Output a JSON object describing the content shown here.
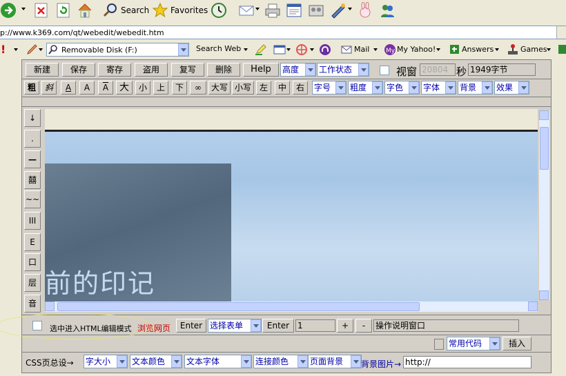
{
  "toolbar": {
    "search_label": "Search",
    "favorites_label": "Favorites"
  },
  "address": {
    "url": "p://www.k369.com/qt/webedit/webedit.htm"
  },
  "yahoo_bar": {
    "drive_select": "Removable Disk (F:)",
    "search_web": "Search Web",
    "mail": "Mail",
    "my_yahoo": "My Yahoo!",
    "answers": "Answers",
    "games": "Games"
  },
  "editor": {
    "row1": {
      "new": "新建",
      "save": "保存",
      "store": "寄存",
      "steal": "盗用",
      "copy": "复写",
      "delete": "删除",
      "help": "Help",
      "height_select": "高度",
      "status_select": "工作状态",
      "window_label": "视窗",
      "window_value": "20804",
      "sec_label": "秒",
      "bytes_value": "1949字节"
    },
    "row2": {
      "buttons": [
        "粗",
        "斜",
        "A",
        "A",
        "A",
        "大",
        "小",
        "上",
        "下",
        "∞",
        "大写",
        "小写",
        "左",
        "中",
        "右"
      ],
      "selects": [
        "字号",
        "粗度",
        "字色",
        "字体",
        "背景",
        "效果"
      ]
    },
    "side_buttons": [
      "↓",
      ".",
      "—",
      "囍",
      "~~",
      "III",
      "E",
      "口",
      "层",
      "音"
    ],
    "canvas_text": "前的印记",
    "bottom1": {
      "html_mode_label": "选中进入HTML编辑模式",
      "browse_link": "浏览网页",
      "enter1": "Enter",
      "form_select": "选择表单",
      "enter2": "Enter",
      "count_value": "1",
      "plus": "+",
      "minus": "-",
      "instructions": "操作说明窗口"
    },
    "bottom2": {
      "common_code": "常用代码",
      "insert": "插入"
    },
    "bottom3": {
      "css_label": "CSS页总设→",
      "font_size": "字大小",
      "text_color": "文本颜色",
      "text_font": "文本字体",
      "link_color": "连接颜色",
      "page_bg": "页面背景",
      "bg_image_label": "背景图片→",
      "bg_image_value": "http://"
    }
  },
  "colors": {
    "chrome": "#ece9d8",
    "panel": "#d4d0c8",
    "link_red": "#cc0000",
    "select_text": "#0000aa",
    "highlight_ellipse": "#e8e27a"
  }
}
